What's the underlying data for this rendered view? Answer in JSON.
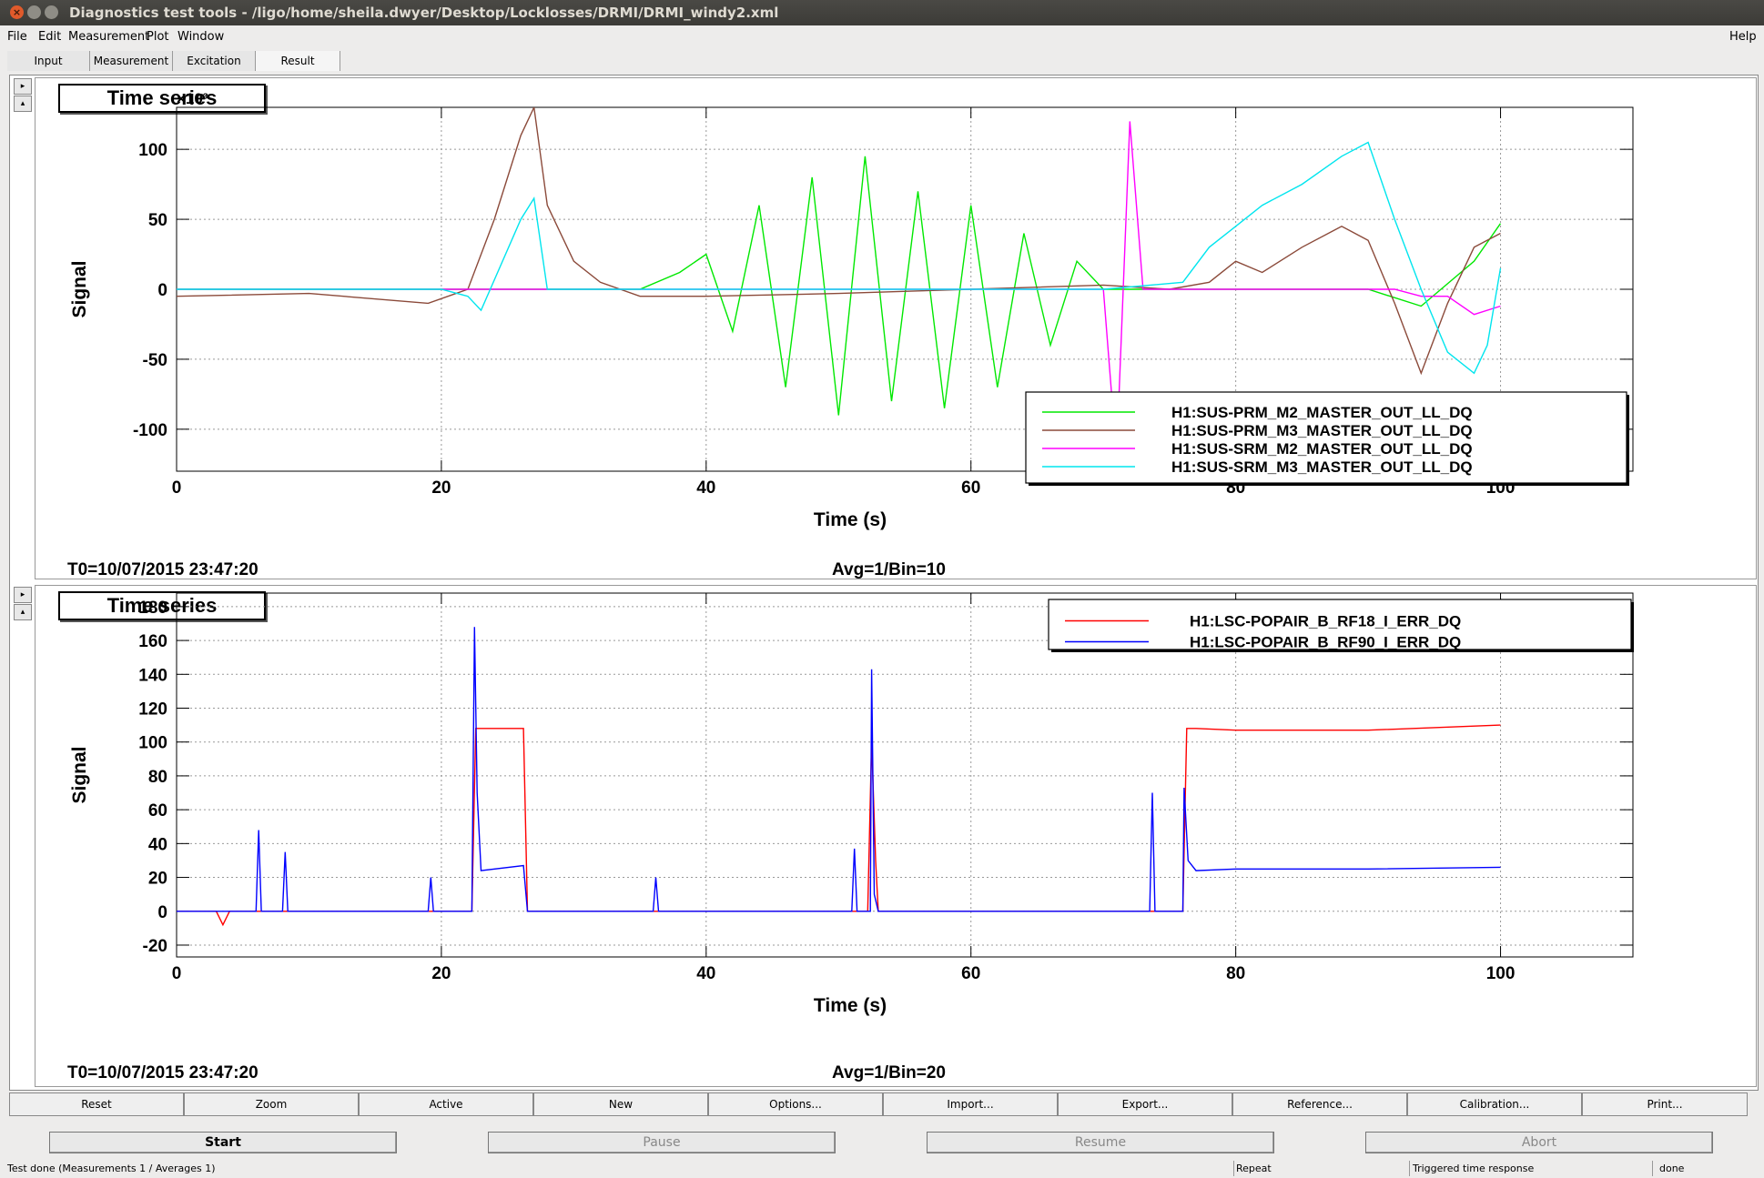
{
  "window": {
    "title": "Diagnostics test tools - /ligo/home/sheila.dwyer/Desktop/Locklosses/DRMI/DRMI_windy2.xml",
    "close_glyph": "×"
  },
  "menu": {
    "file": "File",
    "edit": "Edit",
    "measurement": "Measurement",
    "plot": "Plot",
    "window": "Window",
    "help": "Help"
  },
  "tabs": [
    "Input",
    "Measurement",
    "Excitation",
    "Result"
  ],
  "side_buttons": {
    "expand": "▸",
    "collapse": "▴"
  },
  "panels": [
    {
      "title": "Time series",
      "t0": "T0=10/07/2015 23:47:20",
      "avg": "Avg=1/Bin=10"
    },
    {
      "title": "Time series",
      "t0": "T0=10/07/2015 23:47:20",
      "avg": "Avg=1/Bin=20"
    }
  ],
  "chart_data": [
    {
      "type": "line",
      "xlabel": "Time (s)",
      "ylabel": "Signal",
      "y_multiplier": "×10³",
      "xlim": [
        0,
        110
      ],
      "ylim": [
        -130,
        130
      ],
      "xticks": [
        0,
        20,
        40,
        60,
        80,
        100
      ],
      "yticks": [
        -100,
        -50,
        0,
        50,
        100
      ],
      "grid": true,
      "legend_position": "bottom-right",
      "series": [
        {
          "name": "H1:SUS-PRM_M2_MASTER_OUT_LL_DQ",
          "color": "#00e800",
          "x": [
            0,
            10,
            20,
            30,
            35,
            38,
            40,
            42,
            44,
            46,
            48,
            50,
            52,
            54,
            56,
            58,
            60,
            62,
            64,
            66,
            68,
            70,
            75,
            80,
            85,
            90,
            94,
            98,
            100
          ],
          "y": [
            0,
            0,
            0,
            0,
            0,
            12,
            25,
            -30,
            60,
            -70,
            80,
            -90,
            95,
            -80,
            70,
            -85,
            60,
            -70,
            40,
            -40,
            20,
            0,
            0,
            0,
            0,
            0,
            -12,
            20,
            47
          ]
        },
        {
          "name": "H1:SUS-PRM_M3_MASTER_OUT_LL_DQ",
          "color": "#8b4a3a",
          "x": [
            0,
            10,
            19,
            22,
            24,
            26,
            27,
            28,
            30,
            32,
            35,
            40,
            50,
            60,
            70,
            75,
            78,
            80,
            82,
            85,
            88,
            90,
            92,
            94,
            96,
            98,
            100
          ],
          "y": [
            -5,
            -3,
            -10,
            0,
            50,
            110,
            130,
            60,
            20,
            5,
            -5,
            -5,
            -3,
            0,
            3,
            0,
            5,
            20,
            12,
            30,
            45,
            35,
            -10,
            -60,
            -10,
            30,
            40
          ]
        },
        {
          "name": "H1:SUS-SRM_M2_MASTER_OUT_LL_DQ",
          "color": "#ff00ff",
          "x": [
            0,
            70,
            71,
            72,
            73,
            80,
            90,
            92,
            94,
            96,
            98,
            100
          ],
          "y": [
            0,
            0,
            -120,
            120,
            0,
            0,
            0,
            0,
            -5,
            -5,
            -18,
            -12
          ]
        },
        {
          "name": "H1:SUS-SRM_M3_MASTER_OUT_LL_DQ",
          "color": "#00e5ee",
          "x": [
            0,
            20,
            22,
            23,
            26,
            27,
            28,
            40,
            60,
            70,
            76,
            78,
            80,
            82,
            85,
            88,
            90,
            92,
            94,
            96,
            98,
            99,
            100
          ],
          "y": [
            0,
            0,
            -5,
            -15,
            50,
            65,
            0,
            0,
            0,
            0,
            5,
            30,
            45,
            60,
            75,
            95,
            105,
            50,
            0,
            -45,
            -60,
            -40,
            15
          ]
        }
      ]
    },
    {
      "type": "line",
      "xlabel": "Time (s)",
      "ylabel": "Signal",
      "xlim": [
        0,
        110
      ],
      "ylim": [
        -27,
        188
      ],
      "xticks": [
        0,
        20,
        40,
        60,
        80,
        100
      ],
      "yticks": [
        -20,
        0,
        20,
        40,
        60,
        80,
        100,
        120,
        140,
        160,
        180
      ],
      "grid": true,
      "legend_position": "top-right",
      "series": [
        {
          "name": "H1:LSC-POPAIR_B_RF18_I_ERR_DQ",
          "color": "#ff0000",
          "x": [
            0,
            3,
            3.5,
            4,
            10,
            19,
            22.3,
            22.6,
            26.2,
            26.5,
            40,
            52.2,
            52.5,
            52.8,
            53,
            60,
            76,
            76.3,
            77,
            80,
            90,
            100
          ],
          "y": [
            0,
            0,
            -8,
            0,
            0,
            0,
            0,
            108,
            108,
            0,
            0,
            0,
            100,
            30,
            0,
            0,
            0,
            108,
            108,
            107,
            107,
            110
          ]
        },
        {
          "name": "H1:LSC-POPAIR_B_RF90_I_ERR_DQ",
          "color": "#0000ff",
          "x": [
            0,
            6,
            6.2,
            6.4,
            8,
            8.2,
            8.4,
            19,
            19.2,
            19.4,
            22.3,
            22.5,
            22.7,
            23,
            26.2,
            26.5,
            36,
            36.2,
            36.4,
            51,
            51.2,
            51.4,
            52.4,
            52.5,
            52.7,
            53,
            73.5,
            73.7,
            73.9,
            76,
            76.1,
            76.4,
            77,
            80,
            90,
            100
          ],
          "y": [
            0,
            0,
            48,
            0,
            0,
            35,
            0,
            0,
            20,
            0,
            0,
            168,
            70,
            24,
            27,
            0,
            0,
            20,
            0,
            0,
            37,
            0,
            0,
            143,
            10,
            0,
            0,
            70,
            0,
            0,
            73,
            30,
            24,
            25,
            25,
            26
          ]
        }
      ]
    }
  ],
  "control_buttons": [
    "Reset",
    "Zoom",
    "Active",
    "New",
    "Options...",
    "Import...",
    "Export...",
    "Reference...",
    "Calibration...",
    "Print..."
  ],
  "run_buttons": {
    "start": "Start",
    "pause": "Pause",
    "resume": "Resume",
    "abort": "Abort"
  },
  "status": {
    "message": "Test done (Measurements 1 / Averages 1)",
    "repeat": "Repeat",
    "mode": "Triggered time response",
    "state": "done"
  }
}
